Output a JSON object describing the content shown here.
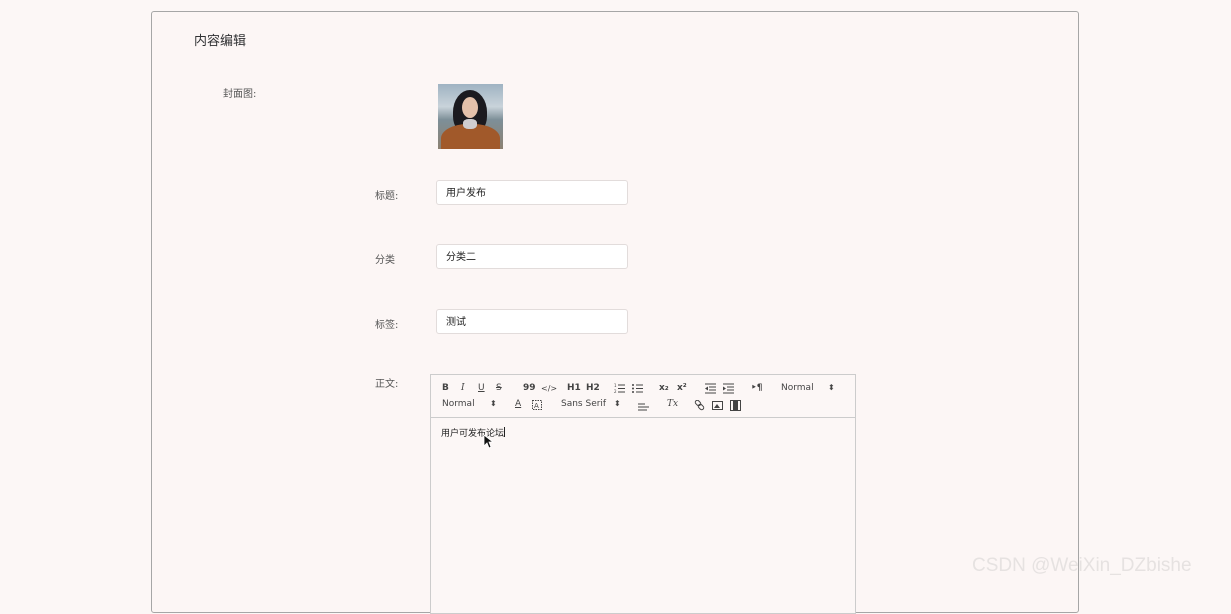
{
  "page": {
    "title": "内容编辑"
  },
  "form": {
    "cover_label": "封面图:",
    "title_label": "标题:",
    "title_value": "用户发布",
    "category_label": "分类",
    "category_value": "分类二",
    "tags_label": "标签:",
    "tags_value": "测试",
    "body_label": "正文:"
  },
  "editor": {
    "toolbar": {
      "bold": "B",
      "italic": "I",
      "underline": "U",
      "strike": "S",
      "blockquote": "99",
      "code": "</>",
      "h1": "H1",
      "h2": "H2",
      "subscript": "x₂",
      "superscript": "x²",
      "size_select": "Normal",
      "header_select": "Normal",
      "font_select": "Sans Serif",
      "color": "A",
      "clean": "Tx"
    },
    "content": "用户可发布论坛"
  },
  "watermark": "CSDN @WeiXin_DZbishe"
}
